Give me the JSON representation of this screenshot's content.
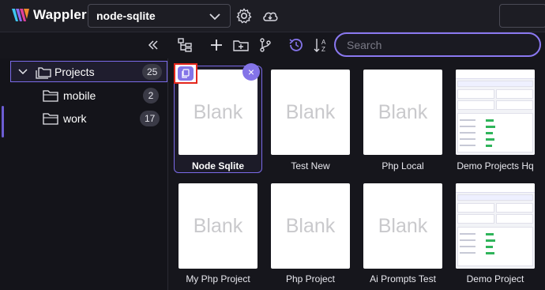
{
  "app": {
    "name": "Wappler"
  },
  "header": {
    "project_select": "node-sqlite",
    "icons": [
      "gear-icon",
      "cloud-sync-icon"
    ]
  },
  "toolbar": {
    "search_placeholder": "Search",
    "icons": [
      "collapse-icon",
      "tree-view-icon",
      "add-icon",
      "add-folder-icon",
      "branch-icon",
      "history-icon",
      "sort-az-icon"
    ]
  },
  "tree": {
    "root": {
      "label": "Projects",
      "count": "25"
    },
    "folders": [
      {
        "label": "mobile",
        "count": "2"
      },
      {
        "label": "work",
        "count": "17"
      }
    ]
  },
  "projects": {
    "blank_label": "Blank",
    "items": [
      {
        "name": "Node Sqlite",
        "thumb": "blank",
        "selected": true
      },
      {
        "name": "Test New",
        "thumb": "blank"
      },
      {
        "name": "Php Local",
        "thumb": "blank"
      },
      {
        "name": "Demo Projects Hq",
        "thumb": "dashboard"
      },
      {
        "name": "My Php Project",
        "thumb": "blank"
      },
      {
        "name": "Php Project",
        "thumb": "blank"
      },
      {
        "name": "Ai Prompts Test",
        "thumb": "blank"
      },
      {
        "name": "Demo Project",
        "thumb": "dashboard"
      }
    ],
    "close_symbol": "×"
  },
  "colors": {
    "accent": "#8474e8",
    "highlight_red": "#e4261b",
    "background": "#16161c"
  }
}
